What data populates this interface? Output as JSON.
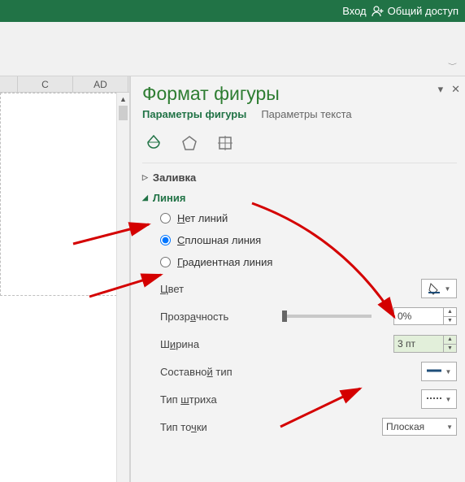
{
  "ribbon": {
    "signin": "Вход",
    "share": "Общий доступ"
  },
  "columns": {
    "c": "C",
    "ad": "AD"
  },
  "pane": {
    "title": "Формат фигуры",
    "tabs": {
      "shape": "Параметры фигуры",
      "text": "Параметры текста"
    },
    "sections": {
      "fill": "Заливка",
      "line": "Линия"
    },
    "line_options": {
      "none_pre": "Н",
      "none_post": "ет линий",
      "solid_pre": "С",
      "solid_post": "плошная линия",
      "grad_pre": "Г",
      "grad_post": "радиентная линия"
    },
    "props": {
      "color_pre": "Ц",
      "color_post": "вет",
      "trans_pre": "Прозр",
      "trans_u": "а",
      "trans_post": "чность",
      "width_pre": "Ш",
      "width_u": "и",
      "width_post": "рина",
      "compound_pre": "Составно",
      "compound_u": "й",
      "compound_post": " тип",
      "dash_pre": "Тип ",
      "dash_u": "ш",
      "dash_post": "триха",
      "cap_pre": "Тип то",
      "cap_u": "ч",
      "cap_post": "ки"
    },
    "values": {
      "transparency": "0%",
      "width": "3 пт",
      "cap": "Плоская"
    }
  }
}
